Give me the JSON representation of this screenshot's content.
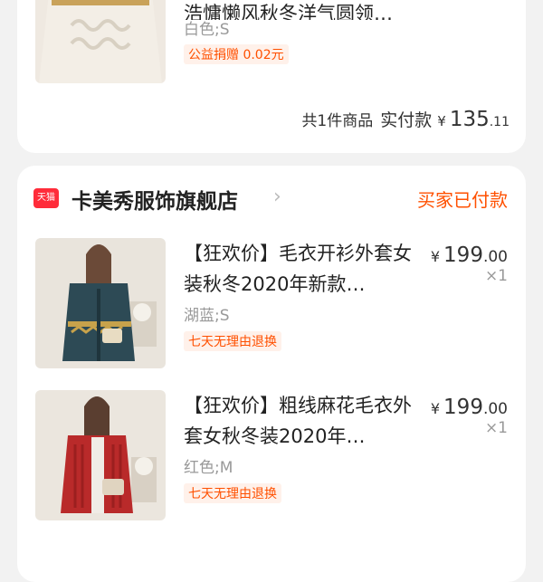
{
  "order1": {
    "item": {
      "title_partial": "浩慵懒风秋冬洋气圆领…",
      "variant": "白色;S",
      "tag": "公益捐赠 0.02元"
    },
    "summary": {
      "count_text": "共1件商品",
      "paid_label": "实付款",
      "currency": "¥",
      "amount_int": "135",
      "amount_dec": ".11"
    }
  },
  "order2": {
    "shop": {
      "logo_text": "天猫",
      "name": "卡美秀服饰旗舰店",
      "status": "买家已付款"
    },
    "items": [
      {
        "title": "【狂欢价】毛衣开衫外套女装秋冬2020年新款…",
        "variant": "湖蓝;S",
        "tag": "七天无理由退换",
        "currency": "¥",
        "price_int": "199",
        "price_dec": ".00",
        "qty": "×1",
        "image_colors": {
          "bg": "#e9e4dc",
          "garment": "#2d4a55",
          "accent": "#c7a24b"
        }
      },
      {
        "title": "【狂欢价】粗线麻花毛衣外套女秋冬装2020年…",
        "variant": "红色;M",
        "tag": "七天无理由退换",
        "currency": "¥",
        "price_int": "199",
        "price_dec": ".00",
        "qty": "×1",
        "image_colors": {
          "bg": "#ebe6de",
          "garment": "#b92a2a",
          "accent": "#f0ece6"
        }
      }
    ]
  },
  "colors": {
    "accent_orange": "#ff5000",
    "tmall_red": "#ff2c3a",
    "page_bg": "#f2f2f2"
  }
}
